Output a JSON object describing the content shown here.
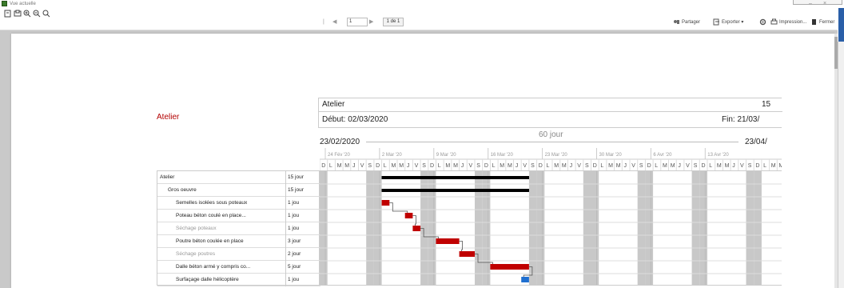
{
  "window": {
    "title": "Vue actuelle",
    "minimize_glyph": "–",
    "close_glyph": "×"
  },
  "toolbar": {
    "left_icons": [
      "page-view-icon",
      "page-setup-icon",
      "zoom-in-icon",
      "zoom-out-icon",
      "zoom-fit-icon"
    ],
    "pager": {
      "first": "|◀",
      "prev": "◀",
      "page": "1",
      "next": "▶",
      "last": "▶|",
      "of": "1 de 1"
    },
    "share_label": "Partager",
    "export_label": "Exporter ▾",
    "print_label": "Impression...",
    "close_label": "Fermer"
  },
  "report": {
    "title": "Atelier",
    "header_name": "Atelier",
    "header_num": "15",
    "start_label": "Début: 02/03/2020",
    "end_label": "Fin: 21/03/",
    "span_start": "23/02/2020",
    "span_duration": "60 jour",
    "span_end": "23/04/",
    "weeks": [
      "24 Fév '20",
      "2 Mar '20",
      "9 Mar '20",
      "16 Mar '20",
      "23 Mar '20",
      "30 Mar '20",
      "6 Avr '20",
      "13 Avr '20"
    ],
    "day_letters": [
      "D",
      "L",
      "M",
      "M",
      "J",
      "V",
      "S"
    ],
    "tasks": [
      {
        "name": "Atelier",
        "duration": "15 jour",
        "indent": 0,
        "grey": false
      },
      {
        "name": "Gros oeuvre",
        "duration": "15 jour",
        "indent": 1,
        "grey": false
      },
      {
        "name": "Semelles isolées sous poteaux",
        "duration": "1 jou",
        "indent": 2,
        "grey": false
      },
      {
        "name": "Poteau béton coulé en place...",
        "duration": "1 jou",
        "indent": 2,
        "grey": false
      },
      {
        "name": "Séchage poteaux",
        "duration": "1 jou",
        "indent": 2,
        "grey": true
      },
      {
        "name": "Poutre béton coulée en place",
        "duration": "3 jour",
        "indent": 2,
        "grey": false
      },
      {
        "name": "Séchage poutres",
        "duration": "2 jour",
        "indent": 2,
        "grey": true
      },
      {
        "name": "Dalle béton armé y compris co...",
        "duration": "5 jour",
        "indent": 2,
        "grey": false
      },
      {
        "name": "Surfaçage dalle hélicoptère",
        "duration": "1 jou",
        "indent": 2,
        "grey": false
      }
    ],
    "colors": {
      "summary_bar": "#000000",
      "task_bar": "#c00000",
      "milestone_bar": "#1f6fd0",
      "weekend_shade": "#c8c8c8",
      "title_red": "#b30000"
    }
  }
}
